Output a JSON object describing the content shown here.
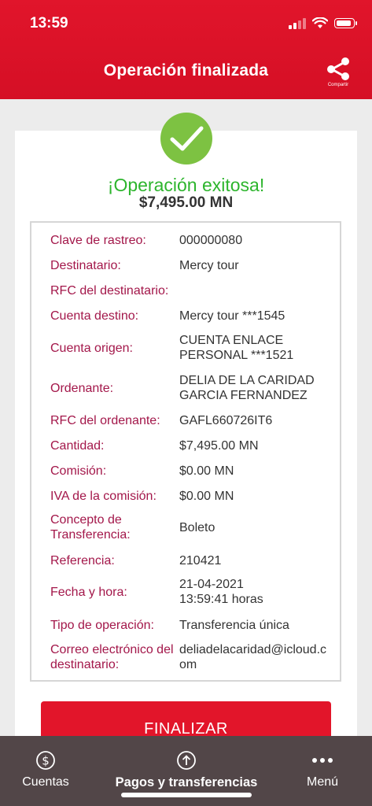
{
  "status_bar": {
    "time": "13:59"
  },
  "header": {
    "title": "Operación finalizada",
    "share_label": "Compartir"
  },
  "result": {
    "message": "¡Operación exitosa!",
    "amount": "$7,495.00 MN"
  },
  "details": [
    {
      "label": "Clave de rastreo:",
      "value": "000000080"
    },
    {
      "label": "Destinatario:",
      "value": "Mercy tour"
    },
    {
      "label": "RFC del destinatario:",
      "value": ""
    },
    {
      "label": "Cuenta destino:",
      "value": "Mercy tour ***1545"
    },
    {
      "label": "Cuenta origen:",
      "value": "CUENTA ENLACE PERSONAL ***1521"
    },
    {
      "label": "Ordenante:",
      "value": "DELIA DE LA CARIDAD GARCIA FERNANDEZ"
    },
    {
      "label": "RFC del ordenante:",
      "value": "GAFL660726IT6"
    },
    {
      "label": "Cantidad:",
      "value": "$7,495.00 MN"
    },
    {
      "label": "Comisión:",
      "value": "$0.00 MN"
    },
    {
      "label": "IVA de la comisión:",
      "value": "$0.00 MN"
    },
    {
      "label": "Concepto de Transferencia:",
      "value": "Boleto"
    },
    {
      "label": "Referencia:",
      "value": "210421"
    },
    {
      "label": "Fecha y hora:",
      "value": "21-04-2021 13:59:41 horas"
    },
    {
      "label": "Tipo de operación:",
      "value": "Transferencia única"
    },
    {
      "label": "Correo electrónico del destinatario:",
      "value": "deliadelacaridad@icloud.com"
    }
  ],
  "buttons": {
    "finalize": "FINALIZAR"
  },
  "bottom_nav": {
    "cuentas": "Cuentas",
    "pagos": "Pagos y transferencias",
    "menu": "Menú"
  },
  "colors": {
    "brand_red": "#e1152b",
    "label_color": "#a3174a",
    "success_green": "#2db52d",
    "nav_bg": "#524648"
  },
  "icons": [
    "signal-icon",
    "wifi-icon",
    "battery-icon",
    "share-icon",
    "check-icon",
    "dollar-icon",
    "upload-icon",
    "more-icon"
  ]
}
